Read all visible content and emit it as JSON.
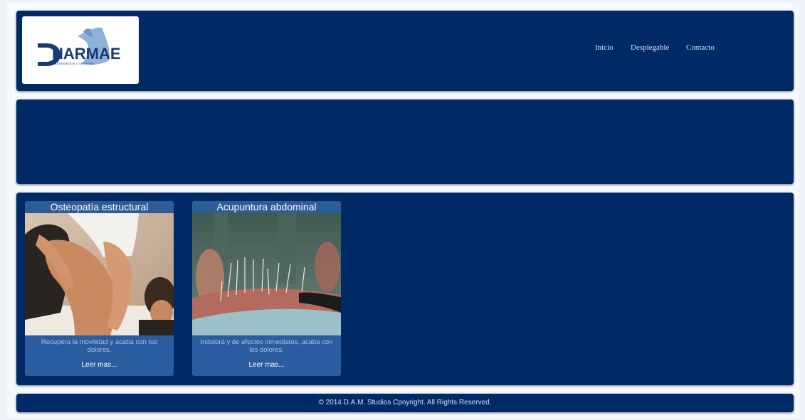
{
  "header": {
    "logo_text": "HARMAE",
    "logo_subtitle": "ENFERMERIA Y TERAPIAS",
    "nav": [
      {
        "label": "Inicio"
      },
      {
        "label": "Desplegable"
      },
      {
        "label": "Contacto"
      }
    ]
  },
  "cards": [
    {
      "title": "Osteopatía estructural",
      "description": "Recupera la movilidad y acaba con tus dolores.",
      "link": "Leer mas..."
    },
    {
      "title": "Acupuntura abdominal",
      "description": "Indolora y de efectos inmediatos, acaba con los dolores.",
      "link": "Leer mas..."
    }
  ],
  "footer": {
    "copyright": "© 2014 D.A.M. Studios Cpoyright. All Rights Reserved."
  },
  "colors": {
    "page_background": "#eef3f9",
    "panel": "#002a66",
    "card": "#2a5da0",
    "nav_text": "#cfe0f5"
  }
}
